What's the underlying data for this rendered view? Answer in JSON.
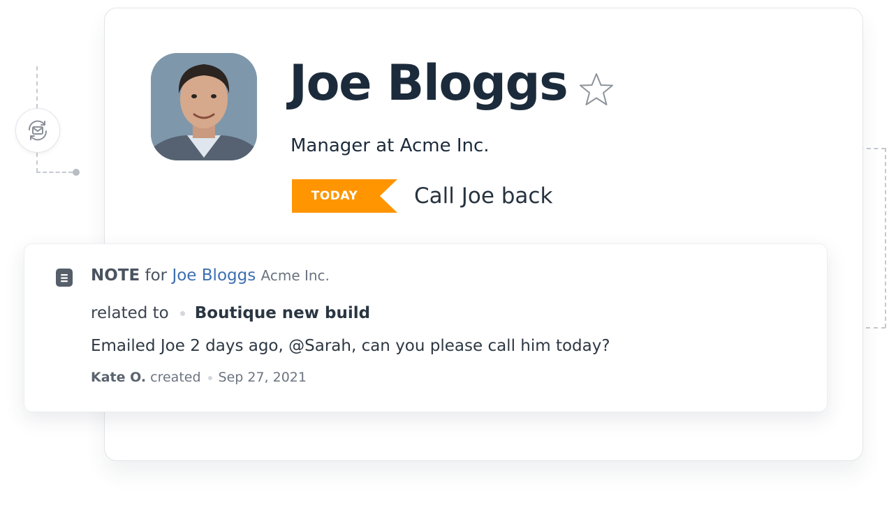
{
  "contact": {
    "name": "Joe Bloggs",
    "title": "Manager at Acme Inc.",
    "avatar_icon": "contact-photo",
    "favorite_icon": "star-outline-icon"
  },
  "task": {
    "tag": "TODAY",
    "tag_color": "#ff9500",
    "text": "Call Joe back"
  },
  "note": {
    "icon": "note-icon",
    "kind": "NOTE",
    "for_word": "for",
    "contact": "Joe Bloggs",
    "company": "Acme Inc.",
    "related_label": "related to",
    "related_item": "Boutique new build",
    "body": "Emailed Joe 2 days ago, @Sarah, can you please call him today?",
    "author": "Kate O.",
    "action": "created",
    "date": "Sep 27, 2021"
  },
  "colors": {
    "accent_orange": "#ff9500",
    "link_blue": "#3d6fb0",
    "heading": "#1c2b3b"
  },
  "decor": {
    "sync_icon": "email-sync-icon"
  }
}
